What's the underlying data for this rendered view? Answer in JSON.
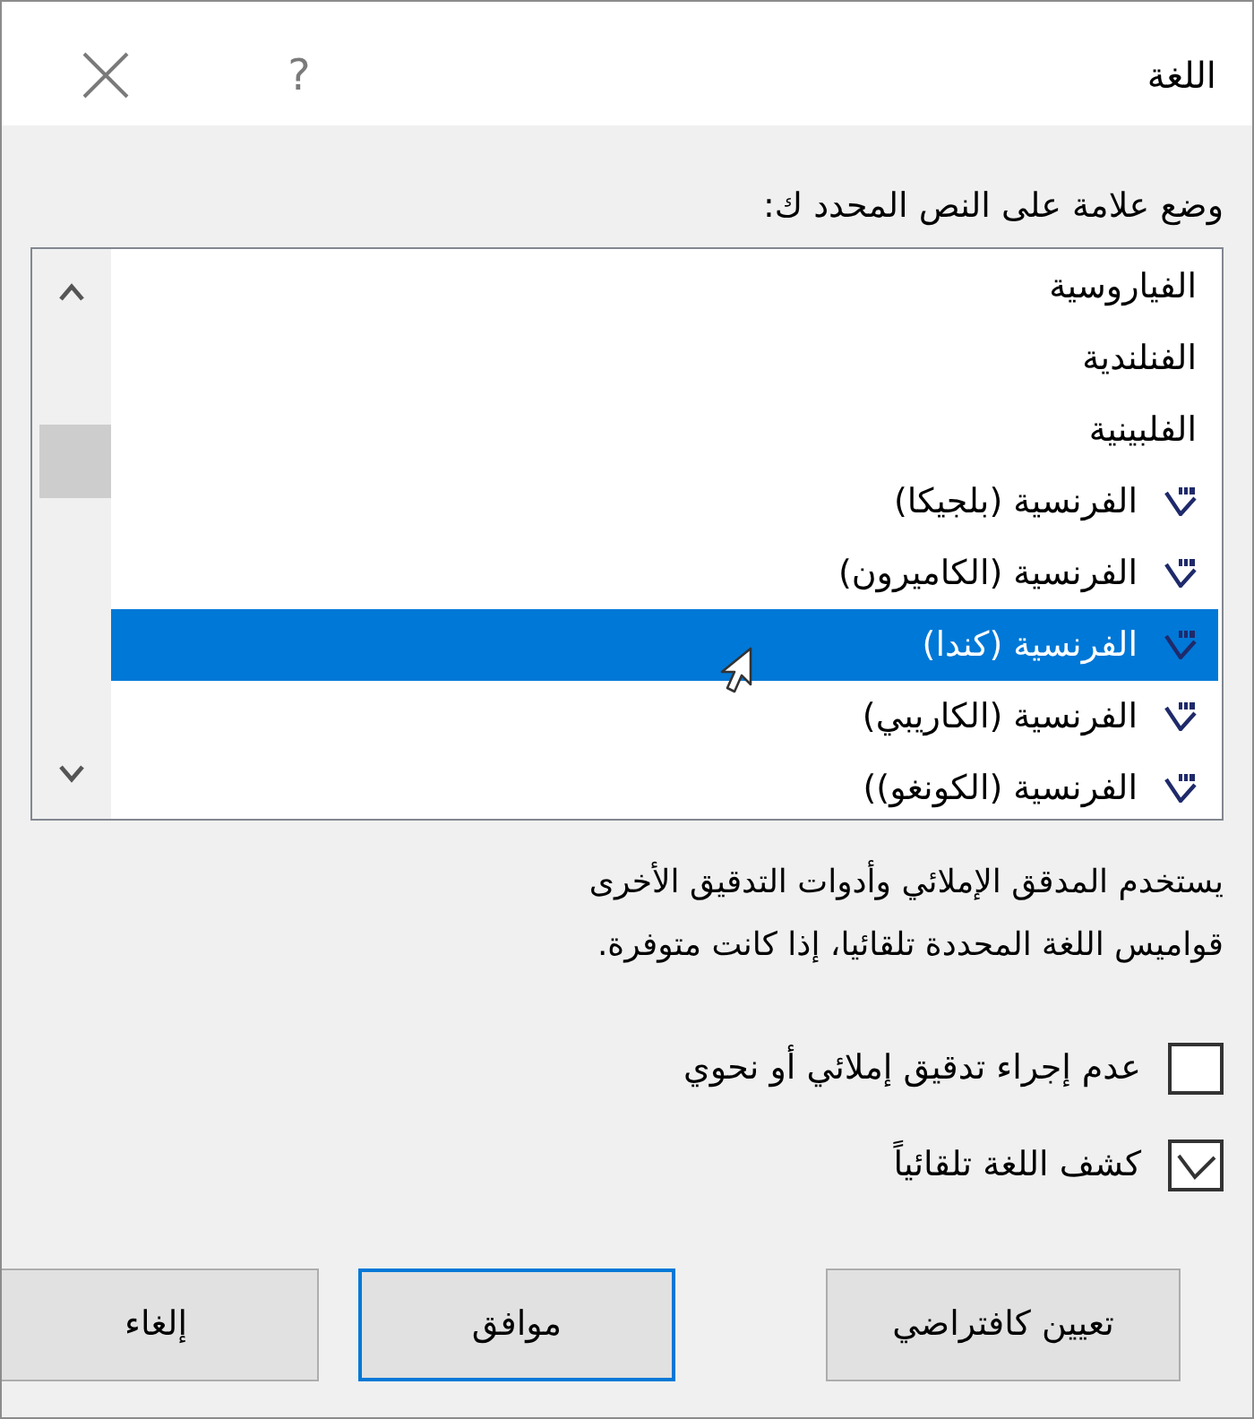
{
  "window": {
    "title": "اللغة",
    "help_button": "?"
  },
  "language_list": {
    "label": "وضع علامة على النص المحدد ك:",
    "items": [
      {
        "name": "الفياروسية",
        "proofing": false,
        "selected": false
      },
      {
        "name": "الفنلندية",
        "proofing": false,
        "selected": false
      },
      {
        "name": "الفلبينية",
        "proofing": false,
        "selected": false
      },
      {
        "name": "الفرنسية (بلجيكا)",
        "proofing": true,
        "selected": false
      },
      {
        "name": "الفرنسية (الكاميرون)",
        "proofing": true,
        "selected": false
      },
      {
        "name": "الفرنسية (كندا)",
        "proofing": true,
        "selected": true
      },
      {
        "name": "الفرنسية (الكاريبي)",
        "proofing": true,
        "selected": false
      },
      {
        "name": "الفرنسية (الكونغو))",
        "proofing": true,
        "selected": false
      }
    ]
  },
  "description": "يستخدم المدقق الإملائي وأدوات التدقيق الأخرى قواميس اللغة المحددة تلقائيا، إذا كانت متوفرة.",
  "options": [
    {
      "label": "عدم إجراء تدقيق إملائي أو نحوي",
      "checked": false
    },
    {
      "label": "كشف اللغة تلقائياً",
      "checked": true
    }
  ],
  "buttons": [
    {
      "label": "تعيين كافتراضي",
      "default": false
    },
    {
      "label": "موافق",
      "default": true
    },
    {
      "label": "إلغاء",
      "default": false
    }
  ]
}
